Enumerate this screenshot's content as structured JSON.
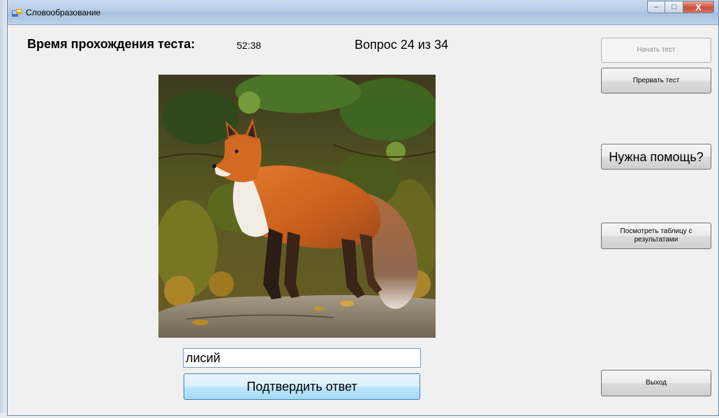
{
  "window": {
    "title": "Словообразование",
    "caption_buttons": {
      "minimize": "‒",
      "maximize": "□",
      "close": "X"
    }
  },
  "header": {
    "time_label": "Время прохождения теста:",
    "timer_value": "52:38",
    "question_progress": "Вопрос 24 из 34"
  },
  "side_buttons": {
    "start_label": "Начать тест",
    "stop_label": "Прервать тест",
    "help_label": "Нужна помощь?",
    "results_label": "Посмотреть таблицу с результатами",
    "exit_label": "Выход"
  },
  "question_image": {
    "subject": "fox-photo"
  },
  "answer": {
    "value": "лисий",
    "confirm_label": "Подтвердить ответ"
  },
  "colors": {
    "window_bg": "#f0f0f0",
    "accent_border": "#3c7fb1",
    "disabled_text": "#8c8c8c"
  }
}
